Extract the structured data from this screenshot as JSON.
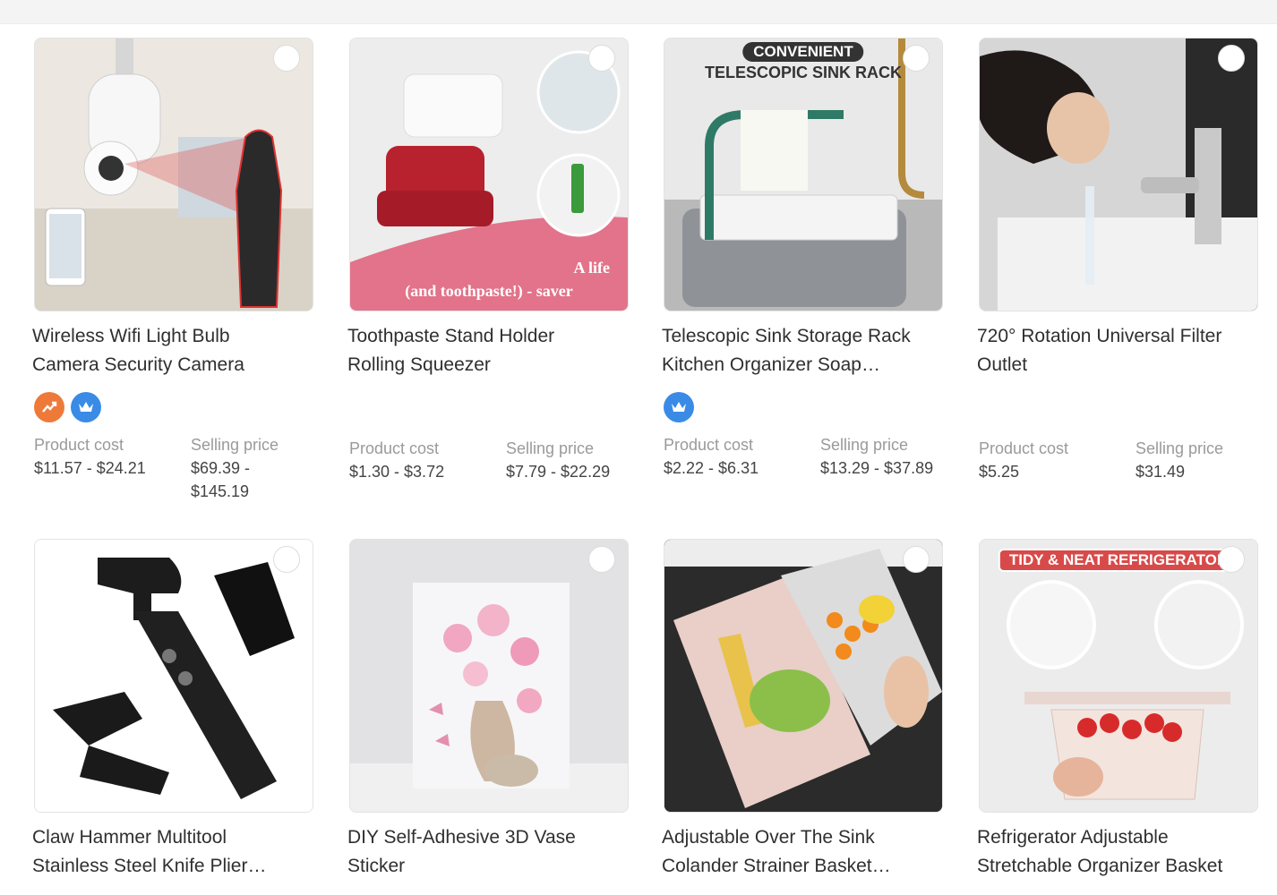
{
  "products": [
    {
      "title_lines": [
        "Wireless Wifi Light Bulb",
        "Camera Security Camera"
      ],
      "badges": [
        "trending-icon",
        "crown-icon"
      ],
      "cost_label": "Product cost",
      "cost_value": "$11.57 - $24.21",
      "sell_label": "Selling price",
      "sell_value_lines": [
        "$69.39 -",
        "$145.19"
      ]
    },
    {
      "title_lines": [
        "Toothpaste Stand Holder",
        "Rolling Squeezer"
      ],
      "image_text": [
        "A life",
        "(and toothpaste!) - saver"
      ],
      "cost_label": "Product cost",
      "cost_value": "$1.30 - $3.72",
      "sell_label": "Selling price",
      "sell_value_lines": [
        "$7.79 - $22.29"
      ]
    },
    {
      "title_lines": [
        "Telescopic Sink Storage Rack",
        "Kitchen Organizer Soap…"
      ],
      "image_text": [
        "CONVENIENT",
        "TELESCOPIC SINK RACK"
      ],
      "badges": [
        "crown-icon"
      ],
      "cost_label": "Product cost",
      "cost_value": "$2.22 - $6.31",
      "sell_label": "Selling price",
      "sell_value_lines": [
        "$13.29 - $37.89"
      ]
    },
    {
      "title_lines": [
        "720° Rotation Universal Filter",
        "Outlet"
      ],
      "cost_label": "Product cost",
      "cost_value": "$5.25",
      "sell_label": "Selling price",
      "sell_value_lines": [
        "$31.49"
      ]
    },
    {
      "title_lines": [
        "Claw Hammer Multitool",
        "Stainless Steel Knife Plier…"
      ]
    },
    {
      "title_lines": [
        "DIY Self-Adhesive 3D Vase",
        "Sticker"
      ]
    },
    {
      "title_lines": [
        "Adjustable Over The Sink",
        "Colander Strainer Basket…"
      ]
    },
    {
      "title_lines": [
        "Refrigerator Adjustable",
        "Stretchable Organizer Basket"
      ],
      "image_text": [
        "TIDY & NEAT REFRIGERATOR"
      ]
    }
  ],
  "colors": {
    "trend_badge": "#ee7a3a",
    "crown_badge": "#3a8be6"
  }
}
